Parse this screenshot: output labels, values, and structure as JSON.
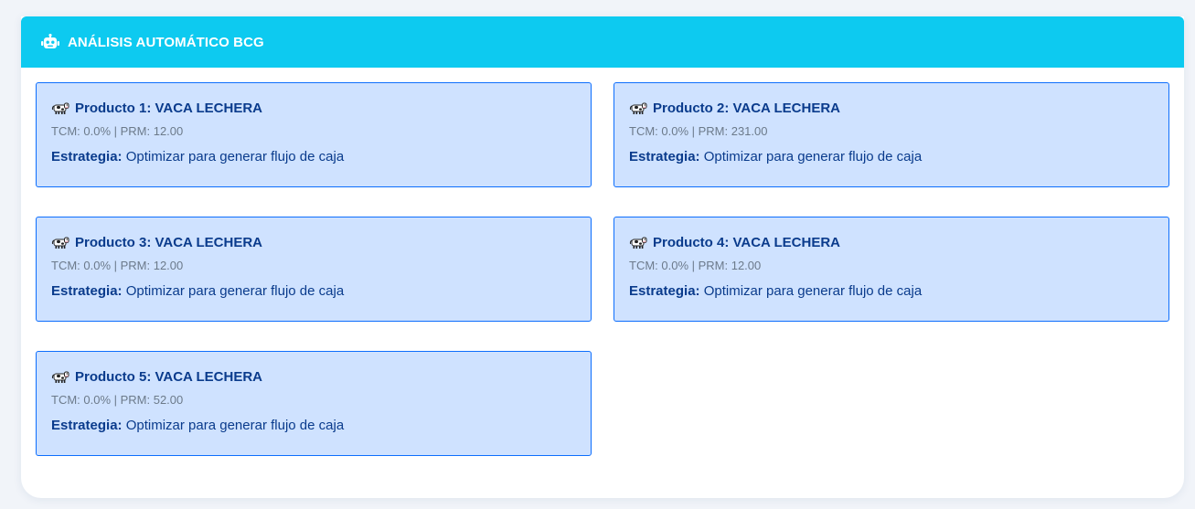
{
  "panel": {
    "title": "ANÁLISIS AUTOMÁTICO BCG",
    "icon": "robot-icon",
    "header_color": "#0dcaf0"
  },
  "colors": {
    "card_bg": "#cfe2ff",
    "card_border": "#0d6efd",
    "card_text": "#0a3b8c"
  },
  "products": [
    {
      "icon": "cow-icon",
      "title": "Producto 1: VACA LECHERA",
      "metrics": "TCM: 0.0% | PRM: 12.00",
      "strategy_label": "Estrategia:",
      "strategy_text": "Optimizar para generar flujo de caja"
    },
    {
      "icon": "cow-icon",
      "title": "Producto 2: VACA LECHERA",
      "metrics": "TCM: 0.0% | PRM: 231.00",
      "strategy_label": "Estrategia:",
      "strategy_text": "Optimizar para generar flujo de caja"
    },
    {
      "icon": "cow-icon",
      "title": "Producto 3: VACA LECHERA",
      "metrics": "TCM: 0.0% | PRM: 12.00",
      "strategy_label": "Estrategia:",
      "strategy_text": "Optimizar para generar flujo de caja"
    },
    {
      "icon": "cow-icon",
      "title": "Producto 4: VACA LECHERA",
      "metrics": "TCM: 0.0% | PRM: 12.00",
      "strategy_label": "Estrategia:",
      "strategy_text": "Optimizar para generar flujo de caja"
    },
    {
      "icon": "cow-icon",
      "title": "Producto 5: VACA LECHERA",
      "metrics": "TCM: 0.0% | PRM: 52.00",
      "strategy_label": "Estrategia:",
      "strategy_text": "Optimizar para generar flujo de caja"
    }
  ]
}
